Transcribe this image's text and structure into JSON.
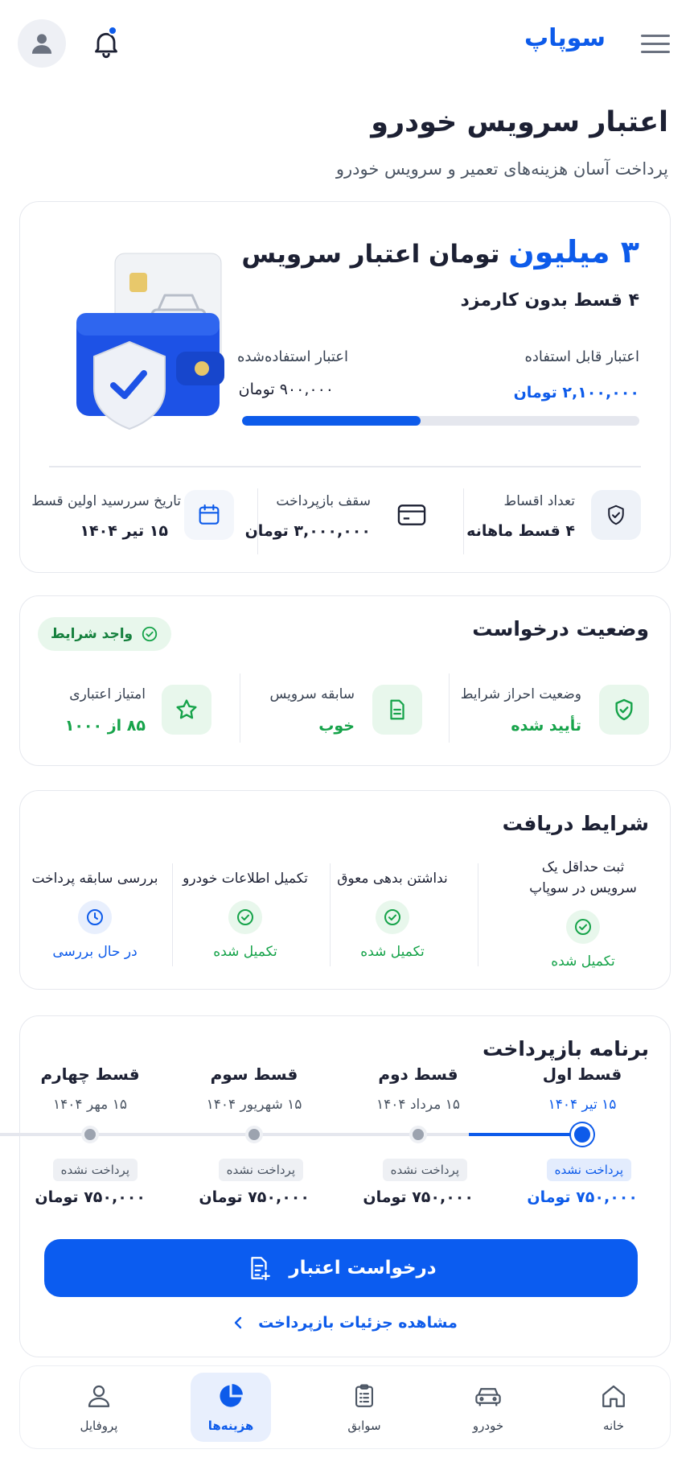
{
  "header": {
    "brand": "سوپاپ",
    "icons": {
      "menu": "menu-icon",
      "bell": "bell-icon",
      "avatar": "user-icon"
    }
  },
  "page": {
    "title": "اعتبار سرویس خودرو",
    "subtitle": "پرداخت آسان هزینه‌های تعمیر و سرویس خودرو"
  },
  "credit": {
    "amount": "۳ میلیون",
    "amount_suffix": "تومان اعتبار سرویس",
    "installments_note": "۴ قسط بدون کارمزد",
    "available_label": "اعتبار قابل استفاده",
    "available_value": "۲,۱۰۰,۰۰۰ تومان",
    "used_label": "اعتبار استفاده‌شده",
    "used_value": "۹۰۰,۰۰۰ تومان",
    "progress_fraction": 0.45,
    "stats": [
      {
        "label": "تعداد اقساط",
        "value": "۴ قسط ماهانه",
        "icon": "shield-check-icon"
      },
      {
        "label": "سقف بازپرداخت",
        "value": "۳,۰۰۰,۰۰۰ تومان",
        "icon": "card-icon"
      },
      {
        "label": "تاریخ سررسید اولین قسط",
        "value": "۱۵ تیر ۱۴۰۴",
        "icon": "calendar-icon"
      }
    ]
  },
  "status": {
    "title": "وضعیت درخواست",
    "badge": "واجد شرایط",
    "items": [
      {
        "label": "وضعیت احراز شرایط",
        "value": "تأیید شده",
        "icon": "shield-check-icon"
      },
      {
        "label": "سابقه سرویس",
        "value": "خوب",
        "icon": "document-icon"
      },
      {
        "label": "امتیاز اعتباری",
        "value": "۸۵ از ۱۰۰۰",
        "icon": "star-icon"
      }
    ]
  },
  "conditions": {
    "title": "شرایط دریافت",
    "items": [
      {
        "title": "ثبت حداقل یک سرویس در سوپاپ",
        "status": "تکمیل شده",
        "state": "done"
      },
      {
        "title": "نداشتن بدهی معوق",
        "status": "تکمیل شده",
        "state": "done"
      },
      {
        "title": "تکمیل اطلاعات خودرو",
        "status": "تکمیل شده",
        "state": "done"
      },
      {
        "title": "بررسی سابقه پرداخت",
        "status": "در حال بررسی",
        "state": "pending"
      }
    ]
  },
  "schedule": {
    "title": "برنامه بازپرداخت",
    "steps": [
      {
        "title": "قسط اول",
        "date": "۱۵ تیر ۱۴۰۴",
        "status": "پرداخت نشده",
        "amount": "۷۵۰,۰۰۰ تومان",
        "active": true
      },
      {
        "title": "قسط دوم",
        "date": "۱۵ مرداد ۱۴۰۴",
        "status": "پرداخت نشده",
        "amount": "۷۵۰,۰۰۰ تومان",
        "active": false
      },
      {
        "title": "قسط سوم",
        "date": "۱۵ شهریور ۱۴۰۴",
        "status": "پرداخت نشده",
        "amount": "۷۵۰,۰۰۰ تومان",
        "active": false
      },
      {
        "title": "قسط چهارم",
        "date": "۱۵ مهر ۱۴۰۴",
        "status": "پرداخت نشده",
        "amount": "۷۵۰,۰۰۰ تومان",
        "active": false
      }
    ],
    "cta": "درخواست اعتبار",
    "link": "مشاهده جزئیات بازپرداخت"
  },
  "nav": {
    "items": [
      {
        "label": "خانه",
        "icon": "home-icon"
      },
      {
        "label": "خودرو",
        "icon": "car-icon"
      },
      {
        "label": "سوابق",
        "icon": "clipboard-icon"
      },
      {
        "label": "هزینه‌ها",
        "icon": "pie-chart-icon",
        "active": true
      },
      {
        "label": "پروفایل",
        "icon": "user-icon"
      }
    ]
  },
  "colors": {
    "primary": "#0d5bea",
    "success": "#16a34a",
    "muted": "#9ca3af"
  }
}
